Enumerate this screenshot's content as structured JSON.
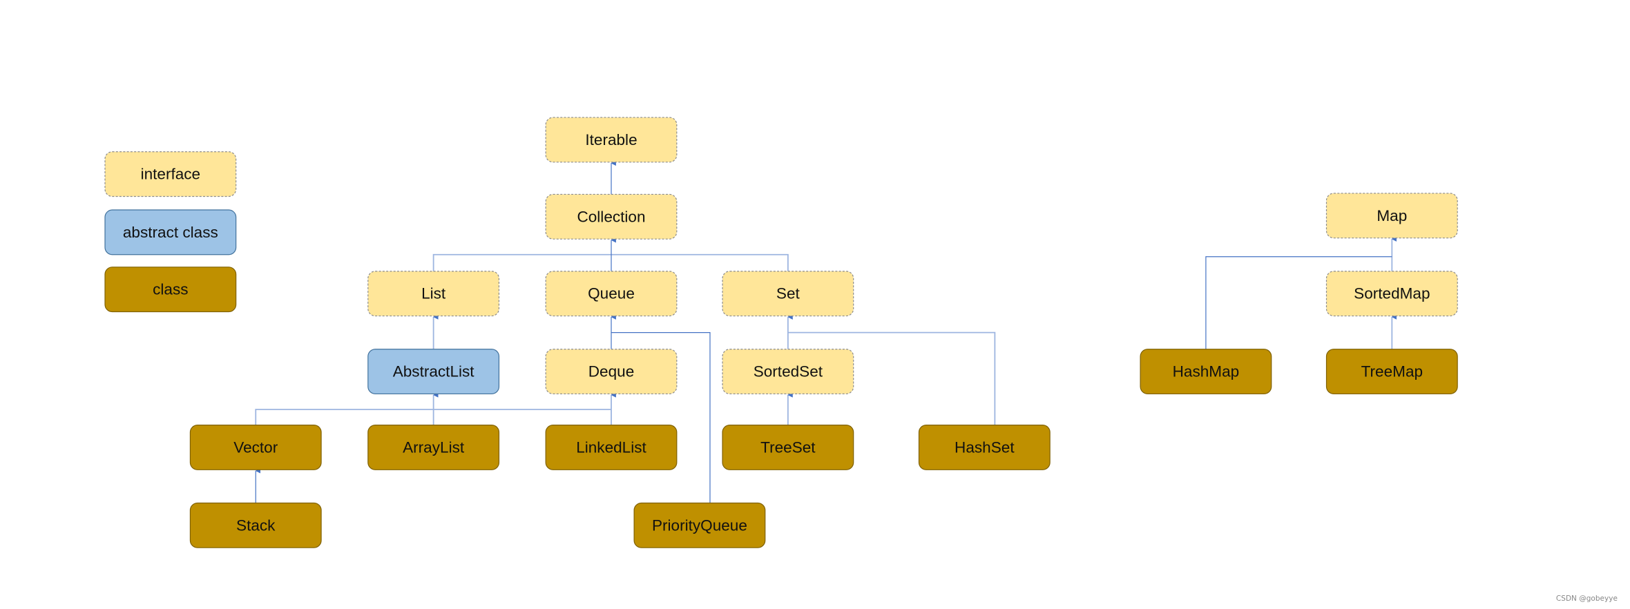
{
  "colors": {
    "interface_fill": "#FFE699",
    "interface_stroke": "#8C8C8C",
    "abstract_fill": "#9DC3E6",
    "abstract_stroke": "#41719C",
    "class_fill": "#BF9000",
    "class_stroke": "#7F6000",
    "edge": "#4472C4"
  },
  "legend": [
    {
      "id": "legend-interface",
      "type": "interface",
      "label": "interface"
    },
    {
      "id": "legend-abstract",
      "type": "abstract",
      "label": "abstract class"
    },
    {
      "id": "legend-class",
      "type": "class",
      "label": "class"
    }
  ],
  "nodes": [
    {
      "id": "Iterable",
      "type": "interface",
      "label": "Iterable"
    },
    {
      "id": "Collection",
      "type": "interface",
      "label": "Collection"
    },
    {
      "id": "List",
      "type": "interface",
      "label": "List"
    },
    {
      "id": "Queue",
      "type": "interface",
      "label": "Queue"
    },
    {
      "id": "Set",
      "type": "interface",
      "label": "Set"
    },
    {
      "id": "AbstractList",
      "type": "abstract",
      "label": "AbstractList"
    },
    {
      "id": "Deque",
      "type": "interface",
      "label": "Deque"
    },
    {
      "id": "SortedSet",
      "type": "interface",
      "label": "SortedSet"
    },
    {
      "id": "Vector",
      "type": "class",
      "label": "Vector"
    },
    {
      "id": "ArrayList",
      "type": "class",
      "label": "ArrayList"
    },
    {
      "id": "LinkedList",
      "type": "class",
      "label": "LinkedList"
    },
    {
      "id": "TreeSet",
      "type": "class",
      "label": "TreeSet"
    },
    {
      "id": "HashSet",
      "type": "class",
      "label": "HashSet"
    },
    {
      "id": "Stack",
      "type": "class",
      "label": "Stack"
    },
    {
      "id": "PriorityQueue",
      "type": "class",
      "label": "PriorityQueue"
    },
    {
      "id": "Map",
      "type": "interface",
      "label": "Map"
    },
    {
      "id": "SortedMap",
      "type": "interface",
      "label": "SortedMap"
    },
    {
      "id": "HashMap",
      "type": "class",
      "label": "HashMap"
    },
    {
      "id": "TreeMap",
      "type": "class",
      "label": "TreeMap"
    }
  ],
  "edges": [
    [
      "Collection",
      "Iterable"
    ],
    [
      "List",
      "Collection"
    ],
    [
      "Queue",
      "Collection"
    ],
    [
      "Set",
      "Collection"
    ],
    [
      "AbstractList",
      "List"
    ],
    [
      "Deque",
      "Queue"
    ],
    [
      "PriorityQueue",
      "Queue"
    ],
    [
      "SortedSet",
      "Set"
    ],
    [
      "HashSet",
      "Set"
    ],
    [
      "Vector",
      "AbstractList"
    ],
    [
      "ArrayList",
      "AbstractList"
    ],
    [
      "LinkedList",
      "AbstractList"
    ],
    [
      "LinkedList",
      "Deque"
    ],
    [
      "TreeSet",
      "SortedSet"
    ],
    [
      "Stack",
      "Vector"
    ],
    [
      "SortedMap",
      "Map"
    ],
    [
      "HashMap",
      "Map"
    ],
    [
      "TreeMap",
      "SortedMap"
    ]
  ],
  "watermark": "CSDN @gobeyye"
}
